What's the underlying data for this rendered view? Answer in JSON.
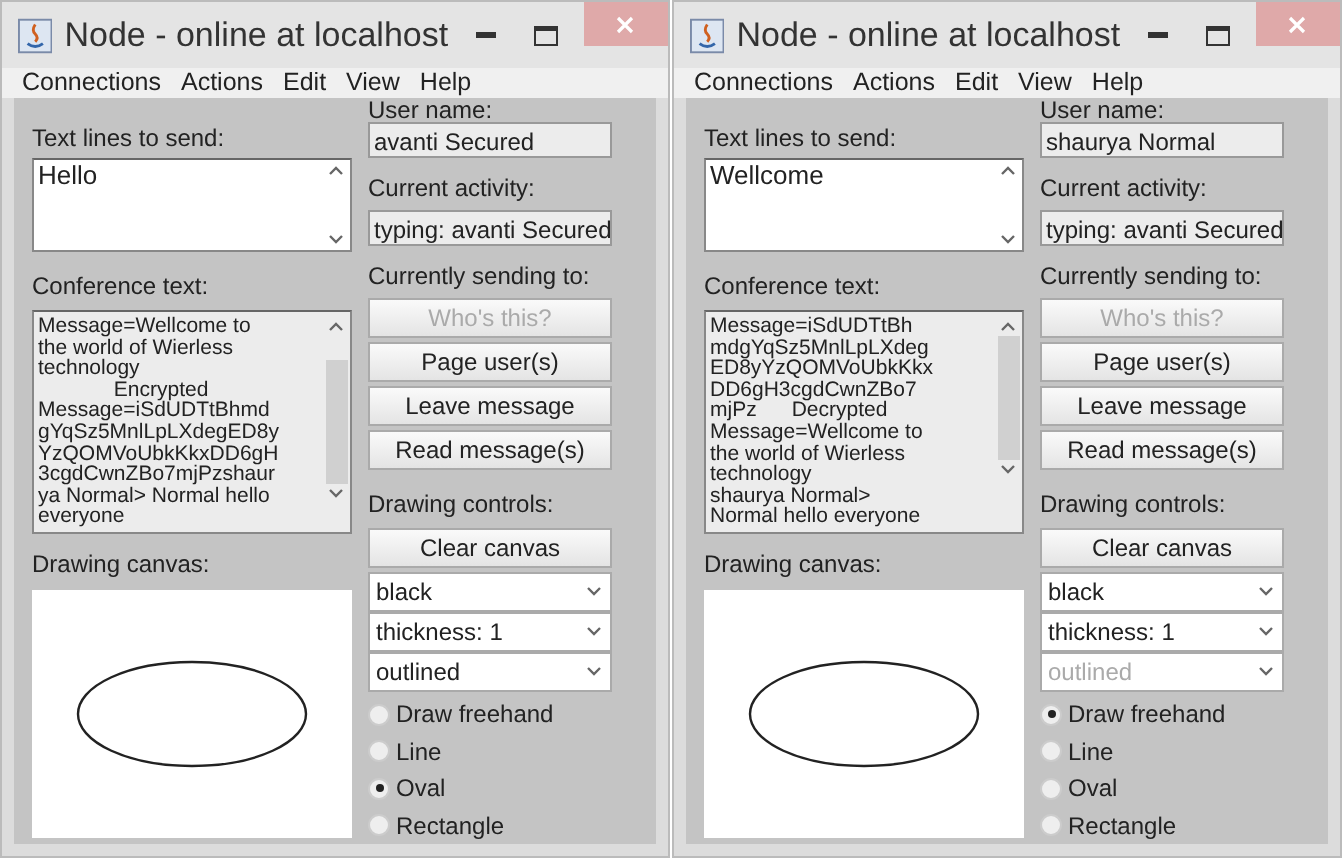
{
  "windows": [
    {
      "title": "Node - online at localhost",
      "menu": [
        "Connections",
        "Actions",
        "Edit",
        "View",
        "Help"
      ],
      "send_label": "Text lines to send:",
      "send_text": "Hello",
      "conference_label": "Conference text:",
      "conference_lines": [
        "Message=Wellcome to",
        "the world of Wierless",
        "technology",
        "             Encrypted",
        "Message=iSdUDTtBhmd",
        "gYqSz5MnlLpLXdegED8y",
        "YzQOMVoUbkKkxDD6gH",
        "3cgdCwnZBo7mjPzshaur",
        "ya Normal> Normal hello",
        "everyone"
      ],
      "canvas_label": "Drawing canvas:",
      "user_label": "User name:",
      "user_value": "avanti Secured",
      "activity_label": "Current activity:",
      "activity_value": "typing: avanti Secured",
      "sending_label": "Currently sending to:",
      "buttons": [
        {
          "label": "Who's this?",
          "disabled": true
        },
        {
          "label": "Page user(s)",
          "disabled": false
        },
        {
          "label": "Leave message",
          "disabled": false
        },
        {
          "label": "Read message(s)",
          "disabled": false
        }
      ],
      "drawing_label": "Drawing controls:",
      "clear_button": "Clear canvas",
      "selects": [
        {
          "value": "black",
          "disabled": false
        },
        {
          "value": "thickness: 1",
          "disabled": false
        },
        {
          "value": "outlined",
          "disabled": false
        }
      ],
      "tools": [
        {
          "label": "Draw freehand",
          "selected": false
        },
        {
          "label": "Line",
          "selected": false
        },
        {
          "label": "Oval",
          "selected": true
        },
        {
          "label": "Rectangle",
          "selected": false
        }
      ]
    },
    {
      "title": "Node - online at localhost",
      "menu": [
        "Connections",
        "Actions",
        "Edit",
        "View",
        "Help"
      ],
      "send_label": "Text lines to send:",
      "send_text": "Wellcome",
      "conference_label": "Conference text:",
      "conference_lines": [
        "Message=iSdUDTtBh",
        "mdgYqSz5MnlLpLXdeg",
        "ED8yYzQOMVoUbkKkx",
        "DD6gH3cgdCwnZBo7",
        "mjPz      Decrypted",
        "Message=Wellcome to",
        "the world of Wierless",
        "technology",
        "shaurya Normal>",
        "Normal hello everyone"
      ],
      "canvas_label": "Drawing canvas:",
      "user_label": "User name:",
      "user_value": "shaurya Normal",
      "activity_label": "Current activity:",
      "activity_value": "typing: avanti Secured",
      "sending_label": "Currently sending to:",
      "buttons": [
        {
          "label": "Who's this?",
          "disabled": true
        },
        {
          "label": "Page user(s)",
          "disabled": false
        },
        {
          "label": "Leave message",
          "disabled": false
        },
        {
          "label": "Read message(s)",
          "disabled": false
        }
      ],
      "drawing_label": "Drawing controls:",
      "clear_button": "Clear canvas",
      "selects": [
        {
          "value": "black",
          "disabled": false
        },
        {
          "value": "thickness: 1",
          "disabled": false
        },
        {
          "value": "outlined",
          "disabled": true
        }
      ],
      "tools": [
        {
          "label": "Draw freehand",
          "selected": true
        },
        {
          "label": "Line",
          "selected": false
        },
        {
          "label": "Oval",
          "selected": false
        },
        {
          "label": "Rectangle",
          "selected": false
        }
      ]
    }
  ]
}
